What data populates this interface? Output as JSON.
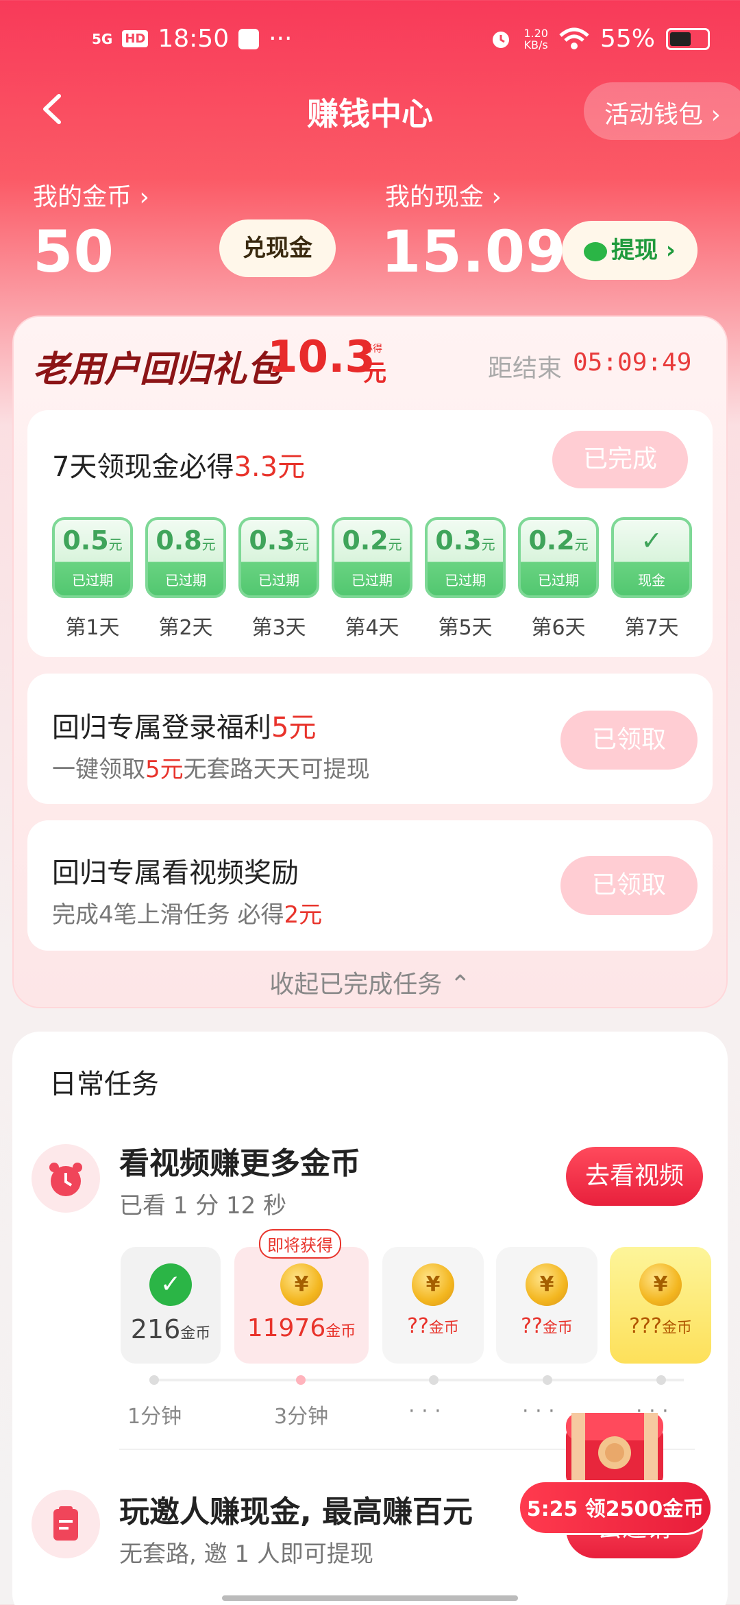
{
  "status_bar": {
    "network": "5G",
    "hd": "HD",
    "time": "18:50",
    "dots": "···",
    "speed_value": "1.20",
    "speed_unit": "KB/s",
    "battery": "55%"
  },
  "header": {
    "title": "赚钱中心",
    "wallet_button": "活动钱包 ›"
  },
  "balances": {
    "coins_label": "我的金币 ›",
    "coins_value": "50",
    "exchange_button": "兑现金",
    "cash_label": "我的现金 ›",
    "cash_value": "15.09",
    "withdraw_button": "提现 ›"
  },
  "gift": {
    "title": "老用户回归礼包",
    "amount": "10.3",
    "badge": "必得",
    "yuan": "元",
    "countdown_label": "距结束",
    "countdown": "05:09:49",
    "collapse_label": "收起已完成任务 ⌃"
  },
  "seven_day": {
    "title_prefix": "7天领现金必得",
    "title_amount": "3.3元",
    "status_button": "已完成",
    "days": [
      {
        "value": "0.5",
        "unit": "元",
        "status": "已过期",
        "label": "第1天"
      },
      {
        "value": "0.8",
        "unit": "元",
        "status": "已过期",
        "label": "第2天"
      },
      {
        "value": "0.3",
        "unit": "元",
        "status": "已过期",
        "label": "第3天"
      },
      {
        "value": "0.2",
        "unit": "元",
        "status": "已过期",
        "label": "第4天"
      },
      {
        "value": "0.3",
        "unit": "元",
        "status": "已过期",
        "label": "第5天"
      },
      {
        "value": "0.2",
        "unit": "元",
        "status": "已过期",
        "label": "第6天"
      },
      {
        "value": "✓",
        "unit": "",
        "status": "现金",
        "label": "第7天"
      }
    ]
  },
  "login_task": {
    "title_prefix": "回归专属登录福利",
    "title_amount": "5元",
    "sub_prefix": "一键领取",
    "sub_amount": "5元",
    "sub_suffix": "无套路天天可提现",
    "button": "已领取"
  },
  "video_task": {
    "title": "回归专属看视频奖励",
    "sub_prefix": "完成4笔上滑任务 必得",
    "sub_amount": "2元",
    "button": "已领取"
  },
  "daily": {
    "section_title": "日常任务",
    "watch": {
      "title": "看视频赚更多金币",
      "sub": "已看 1 分 12 秒",
      "button": "去看视频",
      "upcoming_tag": "即将获得",
      "rewards": [
        {
          "amount": "216",
          "unit": "金币"
        },
        {
          "amount": "11976",
          "unit": "金币"
        },
        {
          "amount": "??",
          "unit": "金币"
        },
        {
          "amount": "??",
          "unit": "金币"
        },
        {
          "amount": "???",
          "unit": "金币"
        }
      ],
      "timeline": [
        "1分钟",
        "3分钟",
        "· · ·",
        "· · ·",
        "· · ·"
      ]
    },
    "invite": {
      "title": "玩邀人赚现金, 最高赚百元",
      "sub": "无套路, 邀 1 人即可提现",
      "button": "去邀请"
    },
    "float_badge": "5:25 领2500金币"
  },
  "colors": {
    "brand_red": "#e8332b",
    "header_red": "#f83a59",
    "done_pink": "#ffcdd3",
    "green": "#52c770"
  }
}
